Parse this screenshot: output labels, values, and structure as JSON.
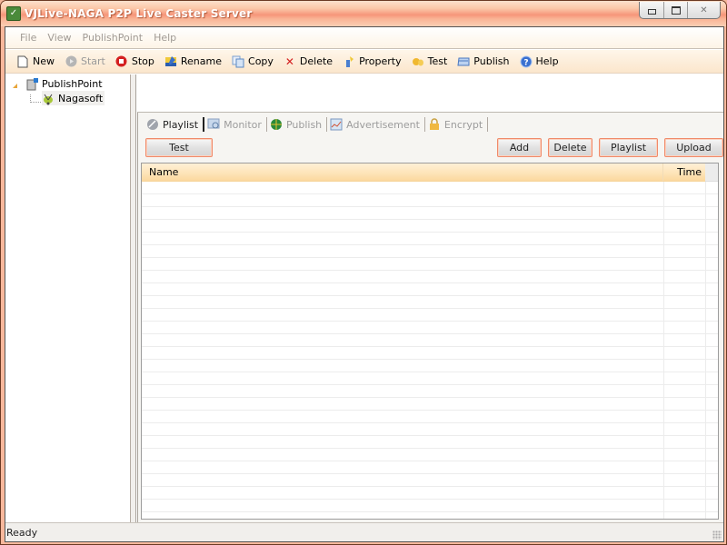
{
  "window": {
    "title": "VJLive-NAGA P2P Live Caster Server",
    "controls": [
      "minimize",
      "restore",
      "close"
    ]
  },
  "menubar": {
    "items": [
      {
        "label": "File"
      },
      {
        "label": "View"
      },
      {
        "label": "PublishPoint"
      },
      {
        "label": "Help"
      }
    ]
  },
  "toolbar": {
    "items": [
      {
        "label": "New",
        "icon": "new-document-icon",
        "enabled": true
      },
      {
        "label": "Start",
        "icon": "start-icon",
        "enabled": false
      },
      {
        "label": "Stop",
        "icon": "stop-icon",
        "enabled": true
      },
      {
        "label": "Rename",
        "icon": "rename-icon",
        "enabled": true
      },
      {
        "label": "Copy",
        "icon": "copy-icon",
        "enabled": true
      },
      {
        "label": "Delete",
        "icon": "delete-icon",
        "enabled": true
      },
      {
        "label": "Property",
        "icon": "property-icon",
        "enabled": true
      },
      {
        "label": "Test",
        "icon": "test-icon",
        "enabled": true
      },
      {
        "label": "Publish",
        "icon": "publish-icon",
        "enabled": true
      },
      {
        "label": "Help",
        "icon": "help-icon",
        "enabled": true
      }
    ]
  },
  "tree": {
    "root": {
      "label": "PublishPoint",
      "expanded": true
    },
    "children": [
      {
        "label": "Nagasoft",
        "selected": true
      }
    ]
  },
  "tabs": [
    {
      "label": "Playlist",
      "active": true
    },
    {
      "label": "Monitor",
      "active": false
    },
    {
      "label": "Publish",
      "active": false
    },
    {
      "label": "Advertisement",
      "active": false
    },
    {
      "label": "Encrypt",
      "active": false
    }
  ],
  "playlist": {
    "buttons": {
      "test": "Test",
      "add": "Add",
      "delete": "Delete",
      "playlist": "Playlist",
      "upload": "Upload"
    },
    "columns": [
      "Name",
      "Time"
    ],
    "rows": []
  },
  "statusbar": {
    "text": "Ready"
  },
  "colors": {
    "title_accent": "#f6957a",
    "button_border": "#f08a6a",
    "grid_header": "#fde3b6"
  }
}
